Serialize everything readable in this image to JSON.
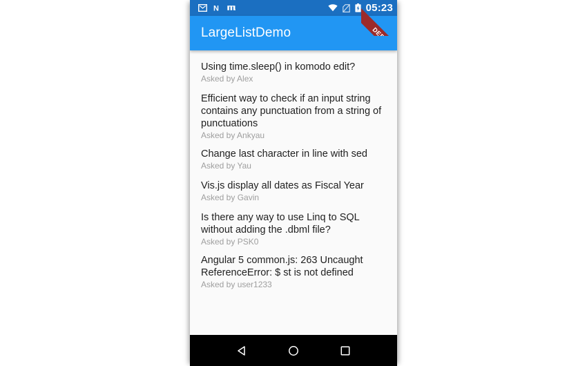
{
  "app": {
    "title": "LargeListDemo",
    "accent_color": "#2196f3",
    "status_bar_color": "#1b6fc1",
    "list_background": "#fafafa",
    "ribbon_color": "#9c2a2a"
  },
  "status_bar": {
    "time": "05:23",
    "left_icons": [
      {
        "name": "gmail-icon",
        "glyph": "envelope"
      },
      {
        "name": "evernote-icon",
        "glyph": "N"
      },
      {
        "name": "mega-icon",
        "glyph": "m"
      }
    ],
    "right_icons": [
      {
        "name": "wifi-icon",
        "glyph": "wifi"
      },
      {
        "name": "no-sim-icon",
        "glyph": "no-sim"
      },
      {
        "name": "battery-charging-icon",
        "glyph": "battery"
      }
    ]
  },
  "ribbon": {
    "label": "DEBUG"
  },
  "list": {
    "items": [
      {
        "title": "Using time.sleep() in komodo edit?",
        "subtitle": "Asked by Alex"
      },
      {
        "title": "Efficient way to check if an input string contains any punctuation from a string of punctuations",
        "subtitle": "Asked by Ankyau"
      },
      {
        "title": "Change last character in line with sed",
        "subtitle": "Asked by Yau"
      },
      {
        "title": "Vis.js display all dates as Fiscal Year",
        "subtitle": "Asked by Gavin"
      },
      {
        "title": "Is there any way to use Linq to SQL without adding the .dbml file?",
        "subtitle": "Asked by PSK0"
      },
      {
        "title": "Angular 5 common.js: 263 Uncaught ReferenceError: $ st is not defined",
        "subtitle": "Asked by user1233"
      }
    ]
  },
  "nav_bar": {
    "back_label": "Back",
    "home_label": "Home",
    "recents_label": "Recents"
  }
}
